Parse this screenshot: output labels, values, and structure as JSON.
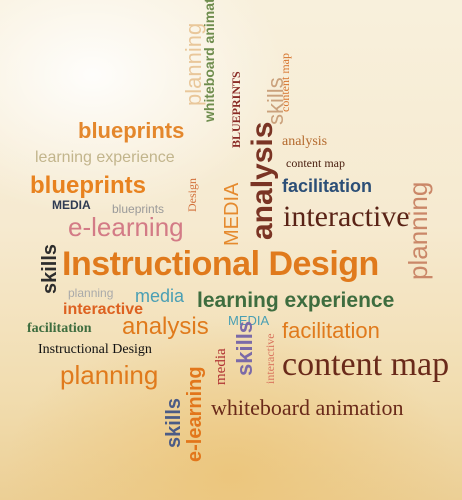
{
  "words": {
    "planning_top": "planning",
    "whiteboard_animation_vert": "whiteboard animation",
    "content_map_vert": "content map",
    "blueprints_vert": "BLUEPRINTS",
    "blueprints_1": "blueprints",
    "analysis_small": "analysis",
    "learning_experience_1": "learning experience",
    "content_map_small": "content map",
    "planning_right_vert": "planning",
    "blueprints_2": "blueprints",
    "design_vert": "Design",
    "media_vert": "MEDIA",
    "analysis_vert": "analysis",
    "skills_vert_small": "skills",
    "facilitation_1": "facilitation",
    "media_small": "MEDIA",
    "blueprints_3": "blueprints",
    "interactive_1": "interactive",
    "e_learning_1": "e-learning",
    "skills_left_vert": "skills",
    "instructional_design_main": "Instructional Design",
    "planning_small": "planning",
    "media_mid": "media",
    "learning_experience_2": "learning experience",
    "interactive_2": "interactive",
    "media_upper": "MEDIA",
    "facilitation_2": "facilitation",
    "analysis_2": "analysis",
    "facilitation_3": "facilitation",
    "instructional_design_small": "Instructional Design",
    "e_learning_vert": "e-learning",
    "media_vert2": "media",
    "skills_vert2": "skills",
    "interactive_vert": "interactive",
    "content_map_big": "content map",
    "planning_bottom": "planning",
    "skills_bottom_vert": "skills",
    "whiteboard_animation_bottom": "whiteboard animation"
  }
}
